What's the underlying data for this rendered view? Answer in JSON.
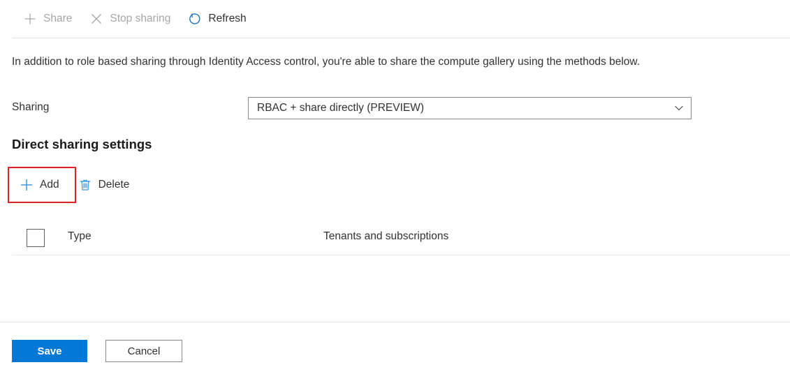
{
  "command_bar": {
    "buttons": [
      {
        "label": "Share",
        "icon": "plus-icon",
        "disabled": true
      },
      {
        "label": "Stop sharing",
        "icon": "close-x-icon",
        "disabled": true
      },
      {
        "label": "Refresh",
        "icon": "refresh-icon",
        "disabled": false
      }
    ]
  },
  "description": "In addition to role based sharing through Identity Access control, you're able to share the compute gallery using the methods below.",
  "sharing": {
    "label": "Sharing",
    "selected_value": "RBAC + share directly (PREVIEW)",
    "chevron": "chevron-down-icon"
  },
  "direct_sharing": {
    "title": "Direct sharing settings",
    "toolbar": [
      {
        "label": "Add",
        "icon": "plus-icon",
        "highlighted": true
      },
      {
        "label": "Delete",
        "icon": "trash-icon",
        "highlighted": false
      }
    ],
    "table": {
      "columns": [
        "Type",
        "Tenants and subscriptions"
      ],
      "rows": []
    }
  },
  "footer": {
    "save_label": "Save",
    "cancel_label": "Cancel"
  },
  "colors": {
    "accent": "#0078d4",
    "highlight": "#e02020",
    "disabled_text": "#a6a6a6",
    "text": "#323130",
    "border": "#8a8886",
    "divider": "#e1e1e1"
  }
}
